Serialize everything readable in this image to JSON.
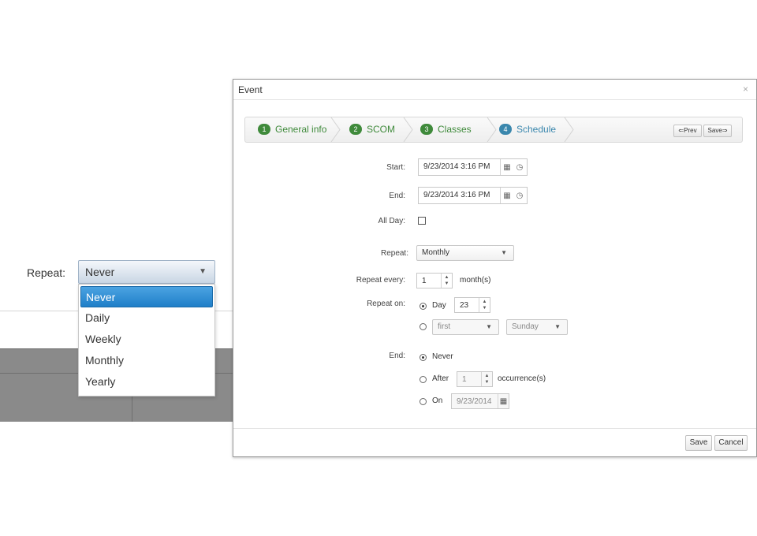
{
  "zoom": {
    "repeat_label": "Repeat:",
    "selected_value": "Never",
    "options": [
      "Never",
      "Daily",
      "Weekly",
      "Monthly",
      "Yearly"
    ]
  },
  "dialog": {
    "title": "Event",
    "close_glyph": "×",
    "wizard": {
      "steps": [
        {
          "num": "1",
          "label": "General info",
          "state": "done"
        },
        {
          "num": "2",
          "label": "SCOM",
          "state": "done"
        },
        {
          "num": "3",
          "label": "Classes",
          "state": "done"
        },
        {
          "num": "4",
          "label": "Schedule",
          "state": "active"
        }
      ],
      "prev_label": "⇐Prev",
      "save_label": "Save⇒"
    },
    "form": {
      "start_label": "Start:",
      "start_value": "9/23/2014 3:16 PM",
      "end_label": "End:",
      "end_value": "9/23/2014 3:16 PM",
      "all_day_label": "All Day:",
      "all_day_checked": false,
      "repeat_label": "Repeat:",
      "repeat_value": "Monthly",
      "repeat_every_label": "Repeat every:",
      "repeat_every_value": "1",
      "repeat_every_unit": "month(s)",
      "repeat_on_label": "Repeat on:",
      "repeat_on_day_label": "Day",
      "repeat_on_day_value": "23",
      "repeat_on_ordinal": "first",
      "repeat_on_weekday": "Sunday",
      "end_rule_label": "End:",
      "end_never_label": "Never",
      "end_after_label": "After",
      "end_after_value": "1",
      "end_after_unit": "occurrence(s)",
      "end_on_label": "On",
      "end_on_value": "9/23/2014"
    },
    "footer": {
      "save_label": "Save",
      "cancel_label": "Cancel"
    }
  }
}
